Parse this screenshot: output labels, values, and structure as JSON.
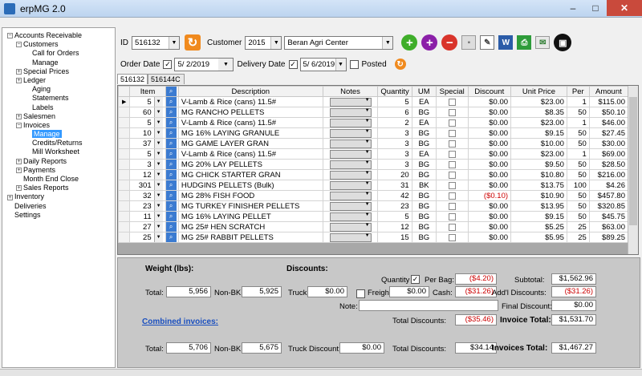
{
  "window": {
    "title": "erpMG 2.0",
    "minimize": "–",
    "maximize": "□",
    "close": "✕"
  },
  "tree": [
    {
      "label": "Accounts Receivable",
      "level": 0,
      "exp": "−"
    },
    {
      "label": "Customers",
      "level": 1,
      "exp": "−"
    },
    {
      "label": "Call for Orders",
      "level": 2,
      "exp": ""
    },
    {
      "label": "Manage",
      "level": 2,
      "exp": ""
    },
    {
      "label": "Special Prices",
      "level": 1,
      "exp": "+"
    },
    {
      "label": "Ledger",
      "level": 1,
      "exp": "+"
    },
    {
      "label": "Aging",
      "level": 2,
      "exp": ""
    },
    {
      "label": "Statements",
      "level": 2,
      "exp": ""
    },
    {
      "label": "Labels",
      "level": 2,
      "exp": ""
    },
    {
      "label": "Salesmen",
      "level": 1,
      "exp": "+"
    },
    {
      "label": "Invoices",
      "level": 1,
      "exp": "−"
    },
    {
      "label": "Manage",
      "level": 2,
      "exp": "",
      "selected": true
    },
    {
      "label": "Credits/Returns",
      "level": 2,
      "exp": ""
    },
    {
      "label": "Mill Worksheet",
      "level": 2,
      "exp": ""
    },
    {
      "label": "Daily Reports",
      "level": 1,
      "exp": "+"
    },
    {
      "label": "Payments",
      "level": 1,
      "exp": "+"
    },
    {
      "label": "Month End Close",
      "level": 1,
      "exp": ""
    },
    {
      "label": "Sales Reports",
      "level": 1,
      "exp": "+"
    },
    {
      "label": "Inventory",
      "level": 0,
      "exp": "+"
    },
    {
      "label": "Deliveries",
      "level": 0,
      "exp": ""
    },
    {
      "label": "Settings",
      "level": 0,
      "exp": ""
    }
  ],
  "header": {
    "id_label": "ID",
    "id_value": "516132",
    "customer_label": "Customer",
    "customer_id": "2015",
    "customer_name": "Beran Agri Center"
  },
  "dates": {
    "order_label": "Order Date",
    "order_value": "5/ 2/2019",
    "delivery_label": "Delivery Date",
    "delivery_value": "5/ 6/2019",
    "posted_label": "Posted"
  },
  "tabs": [
    "516132",
    "516144C"
  ],
  "grid": {
    "columns": [
      "Item",
      "Description",
      "Notes",
      "Quantity",
      "UM",
      "Special",
      "Discount",
      "Unit Price",
      "Per",
      "Amount"
    ],
    "rows": [
      {
        "item": "5",
        "desc": "V-Lamb & Rice (cans) 11.5#",
        "qty": "5",
        "um": "EA",
        "disc": "$0.00",
        "price": "$23.00",
        "per": "1",
        "amount": "$115.00"
      },
      {
        "item": "60",
        "desc": "MG RANCHO PELLETS",
        "qty": "6",
        "um": "BG",
        "disc": "$0.00",
        "price": "$8.35",
        "per": "50",
        "amount": "$50.10"
      },
      {
        "item": "5",
        "desc": "V-Lamb & Rice (cans) 11.5#",
        "qty": "2",
        "um": "EA",
        "disc": "$0.00",
        "price": "$23.00",
        "per": "1",
        "amount": "$46.00"
      },
      {
        "item": "10",
        "desc": "MG 16% LAYING GRANULE",
        "qty": "3",
        "um": "BG",
        "disc": "$0.00",
        "price": "$9.15",
        "per": "50",
        "amount": "$27.45"
      },
      {
        "item": "37",
        "desc": "MG GAME LAYER GRAN",
        "qty": "3",
        "um": "BG",
        "disc": "$0.00",
        "price": "$10.00",
        "per": "50",
        "amount": "$30.00"
      },
      {
        "item": "5",
        "desc": "V-Lamb & Rice (cans) 11.5#",
        "qty": "3",
        "um": "EA",
        "disc": "$0.00",
        "price": "$23.00",
        "per": "1",
        "amount": "$69.00"
      },
      {
        "item": "3",
        "desc": "MG 20% LAY PELLETS",
        "qty": "3",
        "um": "BG",
        "disc": "$0.00",
        "price": "$9.50",
        "per": "50",
        "amount": "$28.50"
      },
      {
        "item": "12",
        "desc": "MG CHICK STARTER GRAN",
        "qty": "20",
        "um": "BG",
        "disc": "$0.00",
        "price": "$10.80",
        "per": "50",
        "amount": "$216.00"
      },
      {
        "item": "301",
        "desc": "HUDGINS PELLETS (Bulk)",
        "qty": "31",
        "um": "BK",
        "disc": "$0.00",
        "price": "$13.75",
        "per": "100",
        "amount": "$4.26"
      },
      {
        "item": "32",
        "desc": "MG 28% FISH FOOD",
        "qty": "42",
        "um": "BG",
        "disc": "($0.10)",
        "price": "$10.90",
        "per": "50",
        "amount": "$457.80"
      },
      {
        "item": "23",
        "desc": "MG TURKEY FINISHER PELLETS",
        "qty": "23",
        "um": "BG",
        "disc": "$0.00",
        "price": "$13.95",
        "per": "50",
        "amount": "$320.85"
      },
      {
        "item": "11",
        "desc": "MG 16% LAYING PELLET",
        "qty": "5",
        "um": "BG",
        "disc": "$0.00",
        "price": "$9.15",
        "per": "50",
        "amount": "$45.75"
      },
      {
        "item": "27",
        "desc": "MG 25# HEN SCRATCH",
        "qty": "12",
        "um": "BG",
        "disc": "$0.00",
        "price": "$5.25",
        "per": "25",
        "amount": "$63.00"
      },
      {
        "item": "25",
        "desc": "MG 25# RABBIT PELLETS",
        "qty": "15",
        "um": "BG",
        "disc": "$0.00",
        "price": "$5.95",
        "per": "25",
        "amount": "$89.25"
      }
    ]
  },
  "summary": {
    "weight_label": "Weight (lbs):",
    "discounts_label": "Discounts:",
    "total_label": "Total:",
    "total_value": "5,956",
    "nonbk_label": "Non-BK:",
    "nonbk_value": "5,925",
    "truck_label": "Truck:",
    "truck_value": "$0.00",
    "quantity_label": "Quantity",
    "perbag_label": "Per Bag:",
    "perbag_value": "($4.20)",
    "freight_label": "Freight:",
    "freight_value": "$0.00",
    "cash_label": "Cash:",
    "cash_value": "($31.26)",
    "note_label": "Note:",
    "totaldisc_label": "Total Discounts:",
    "totaldisc_value": "($35.46)",
    "subtotal_label": "Subtotal:",
    "subtotal_value": "$1,562.96",
    "addl_label": "Add'l Discounts:",
    "addl_value": "($31.26)",
    "final_label": "Final Discount:",
    "final_value": "$0.00",
    "invtotal_label": "Invoice Total:",
    "invtotal_value": "$1,531.70",
    "combined_label": "Combined invoices:",
    "c_total_label": "Total:",
    "c_total_value": "5,706",
    "c_nonbk_label": "Non-BK:",
    "c_nonbk_value": "5,675",
    "c_truck_label": "Truck Discount:",
    "c_truck_value": "$0.00",
    "c_totaldisc_label": "Total Discounts:",
    "c_totaldisc_value": "$34.14",
    "c_invtotal_label": "Invoices Total:",
    "c_invtotal_value": "$1,467.27"
  },
  "colors": {
    "accent": "#3399ff",
    "negative": "#cc0000",
    "link": "#1a4fbf"
  }
}
